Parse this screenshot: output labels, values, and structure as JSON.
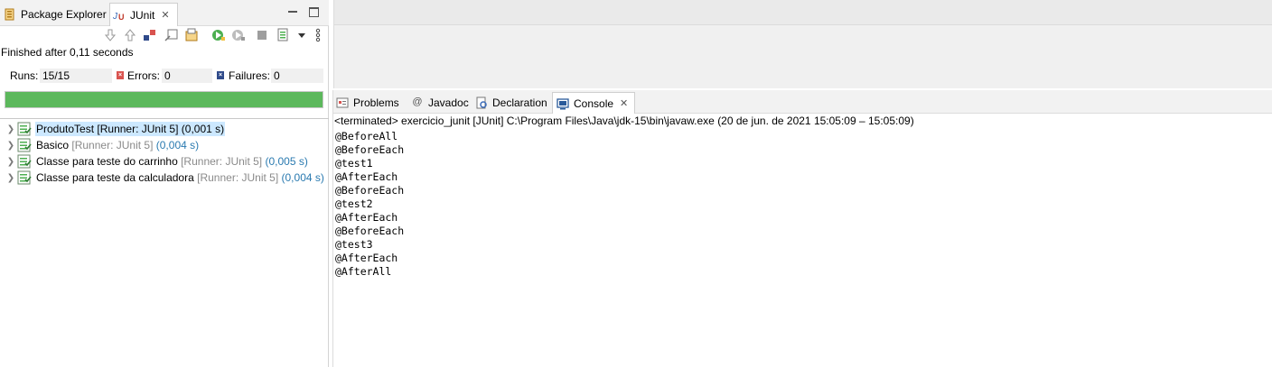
{
  "left_tabs": {
    "package_explorer": "Package Explorer",
    "junit": "JUnit",
    "close_glyph": "✕"
  },
  "toolbar_icons": [
    "next-failure-icon",
    "previous-failure-icon",
    "show-failures-only-icon",
    "scroll-lock-icon",
    "history-icon",
    "rerun-test-icon",
    "rerun-failed-first-icon",
    "stop-icon",
    "test-run-history-icon",
    "dropdown-icon",
    "view-menu-icon"
  ],
  "status": "Finished after 0,11 seconds",
  "counters": {
    "runs_label": "Runs:",
    "runs_value": "15/15",
    "errors_label": "Errors:",
    "errors_value": "0",
    "failures_label": "Failures:",
    "failures_value": "0"
  },
  "progress": {
    "fraction": 1.0,
    "color": "#5cb85c"
  },
  "test_tree": [
    {
      "name": "ProdutoTest",
      "runner": "[Runner: JUnit 5]",
      "time": "(0,001 s)",
      "selected": true
    },
    {
      "name": "Basico",
      "runner": "[Runner: JUnit 5]",
      "time": "(0,004 s)",
      "selected": false
    },
    {
      "name": "Classe para teste do carrinho",
      "runner": "[Runner: JUnit 5]",
      "time": "(0,005 s)",
      "selected": false
    },
    {
      "name": "Classe para teste da calculadora",
      "runner": "[Runner: JUnit 5]",
      "time": "(0,004 s)",
      "selected": false
    }
  ],
  "console_tabs": {
    "problems": "Problems",
    "javadoc": "Javadoc",
    "declaration": "Declaration",
    "console": "Console",
    "javadoc_glyph": "@"
  },
  "console_header": "<terminated> exercicio_junit [JUnit] C:\\Program Files\\Java\\jdk-15\\bin\\javaw.exe  (20 de jun. de 2021 15:05:09 – 15:05:09)",
  "console_lines": [
    "@BeforeAll",
    "@BeforeEach",
    "@test1",
    "@AfterEach",
    "@BeforeEach",
    "@test2",
    "@AfterEach",
    "@BeforeEach",
    "@test3",
    "@AfterEach",
    "@AfterAll"
  ],
  "colors": {
    "selection": "#cce8ff",
    "time_text": "#2a7ab0",
    "runner_text": "#8a8a8a",
    "error_mark": "#d9534f",
    "failure_mark": "#2f4a8a"
  }
}
